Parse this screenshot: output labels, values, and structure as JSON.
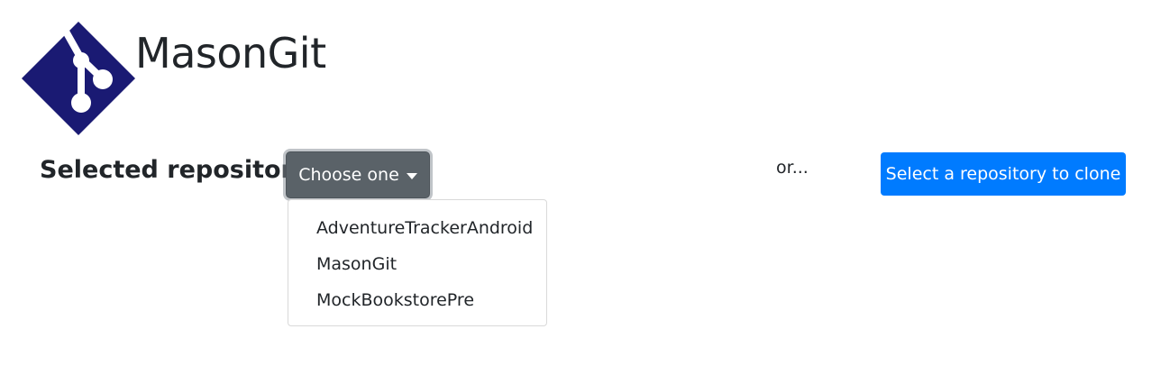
{
  "app": {
    "title": "MasonGit",
    "logo_icon": "git-branch-logo-icon",
    "logo_color": "#1a1a73"
  },
  "repository_selector": {
    "label": "Selected repository:",
    "toggle_label": "Choose one",
    "menu_items": [
      {
        "label": "AdventureTrackerAndroid"
      },
      {
        "label": "MasonGit"
      },
      {
        "label": "MockBookstorePre"
      }
    ]
  },
  "separator_text": "or...",
  "clone_button_label": "Select a repository to clone",
  "colors": {
    "primary": "#007bff",
    "secondary_active": "#5a6268"
  }
}
